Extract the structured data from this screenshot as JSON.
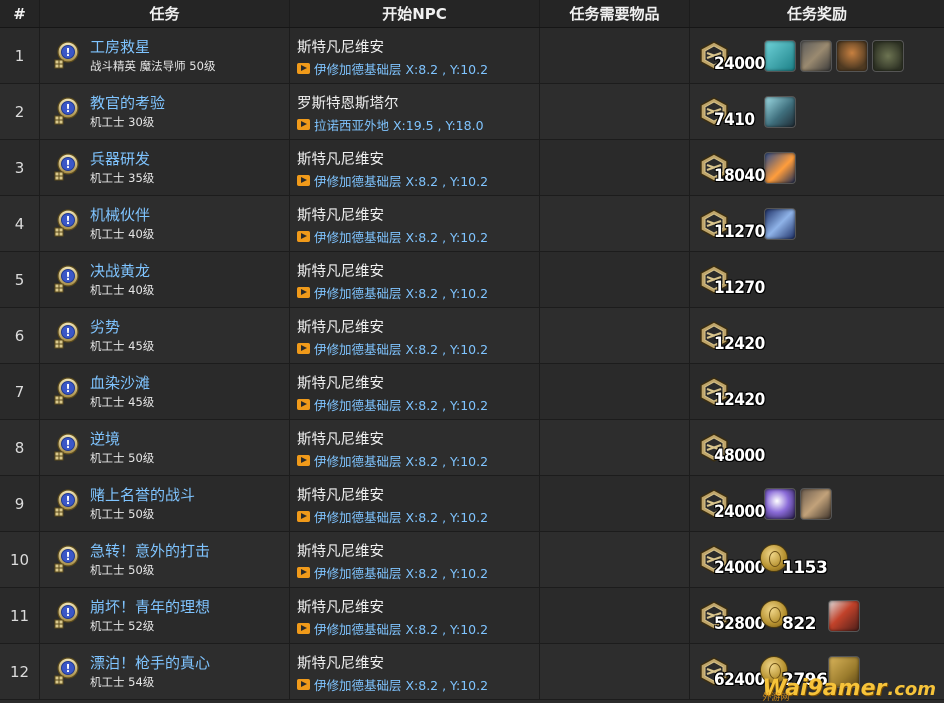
{
  "header": {
    "num": "#",
    "quest": "任务",
    "npc": "开始NPC",
    "items": "任务需要物品",
    "reward": "任务奖励"
  },
  "rows": [
    {
      "num": "1",
      "title": "工房救星",
      "sub": "战斗精英 魔法导师 50级",
      "npc": "斯特凡尼维安",
      "loc": "伊修加德基础层 X:8.2 , Y:10.2",
      "exp": "24000",
      "gil": "",
      "items": [
        "ic-teal",
        "ic-gun",
        "ic-armor",
        "ic-boots"
      ]
    },
    {
      "num": "2",
      "title": "教官的考验",
      "sub": "机工士 30级",
      "npc": "罗斯特恩斯塔尔",
      "loc": "拉诺西亚外地 X:19.5 , Y:18.0",
      "exp": "7410",
      "gil": "",
      "items": [
        "ic-robot"
      ]
    },
    {
      "num": "3",
      "title": "兵器研发",
      "sub": "机工士 35级",
      "npc": "斯特凡尼维安",
      "loc": "伊修加德基础层 X:8.2 , Y:10.2",
      "exp": "18040",
      "gil": "",
      "items": [
        "ic-flame"
      ]
    },
    {
      "num": "4",
      "title": "机械伙伴",
      "sub": "机工士 40级",
      "npc": "斯特凡尼维安",
      "loc": "伊修加德基础层 X:8.2 , Y:10.2",
      "exp": "11270",
      "gil": "",
      "items": [
        "ic-wrench"
      ]
    },
    {
      "num": "5",
      "title": "决战黄龙",
      "sub": "机工士 40级",
      "npc": "斯特凡尼维安",
      "loc": "伊修加德基础层 X:8.2 , Y:10.2",
      "exp": "11270",
      "gil": "",
      "items": []
    },
    {
      "num": "6",
      "title": "劣势",
      "sub": "机工士 45级",
      "npc": "斯特凡尼维安",
      "loc": "伊修加德基础层 X:8.2 , Y:10.2",
      "exp": "12420",
      "gil": "",
      "items": []
    },
    {
      "num": "7",
      "title": "血染沙滩",
      "sub": "机工士 45级",
      "npc": "斯特凡尼维安",
      "loc": "伊修加德基础层 X:8.2 , Y:10.2",
      "exp": "12420",
      "gil": "",
      "items": []
    },
    {
      "num": "8",
      "title": "逆境",
      "sub": "机工士 50级",
      "npc": "斯特凡尼维安",
      "loc": "伊修加德基础层 X:8.2 , Y:10.2",
      "exp": "48000",
      "gil": "",
      "items": []
    },
    {
      "num": "9",
      "title": "赌上名誉的战斗",
      "sub": "机工士 50级",
      "npc": "斯特凡尼维安",
      "loc": "伊修加德基础层 X:8.2 , Y:10.2",
      "exp": "24000",
      "gil": "",
      "items": [
        "ic-spark",
        "ic-hammer"
      ]
    },
    {
      "num": "10",
      "title": "急转！意外的打击",
      "sub": "机工士 50级",
      "npc": "斯特凡尼维安",
      "loc": "伊修加德基础层 X:8.2 , Y:10.2",
      "exp": "24000",
      "gil": "1153",
      "items": []
    },
    {
      "num": "11",
      "title": "崩坏！青年的理想",
      "sub": "机工士 52级",
      "npc": "斯特凡尼维安",
      "loc": "伊修加德基础层 X:8.2 , Y:10.2",
      "exp": "52800",
      "gil": "822",
      "items": [
        "ic-fighter"
      ]
    },
    {
      "num": "12",
      "title": "漂泊！枪手的真心",
      "sub": "机工士 54级",
      "npc": "斯特凡尼维安",
      "loc": "伊修加德基础层 X:8.2 , Y:10.2",
      "exp": "62400",
      "gil": "2796",
      "items": [
        "ic-gold"
      ]
    }
  ],
  "watermark": {
    "main": "Wai9amer",
    "domain": ".com",
    "cn": "外游网"
  },
  "colors": {
    "link": "#7fc4ff",
    "accent": "#f09a1a",
    "background": "#2b2b2b"
  }
}
